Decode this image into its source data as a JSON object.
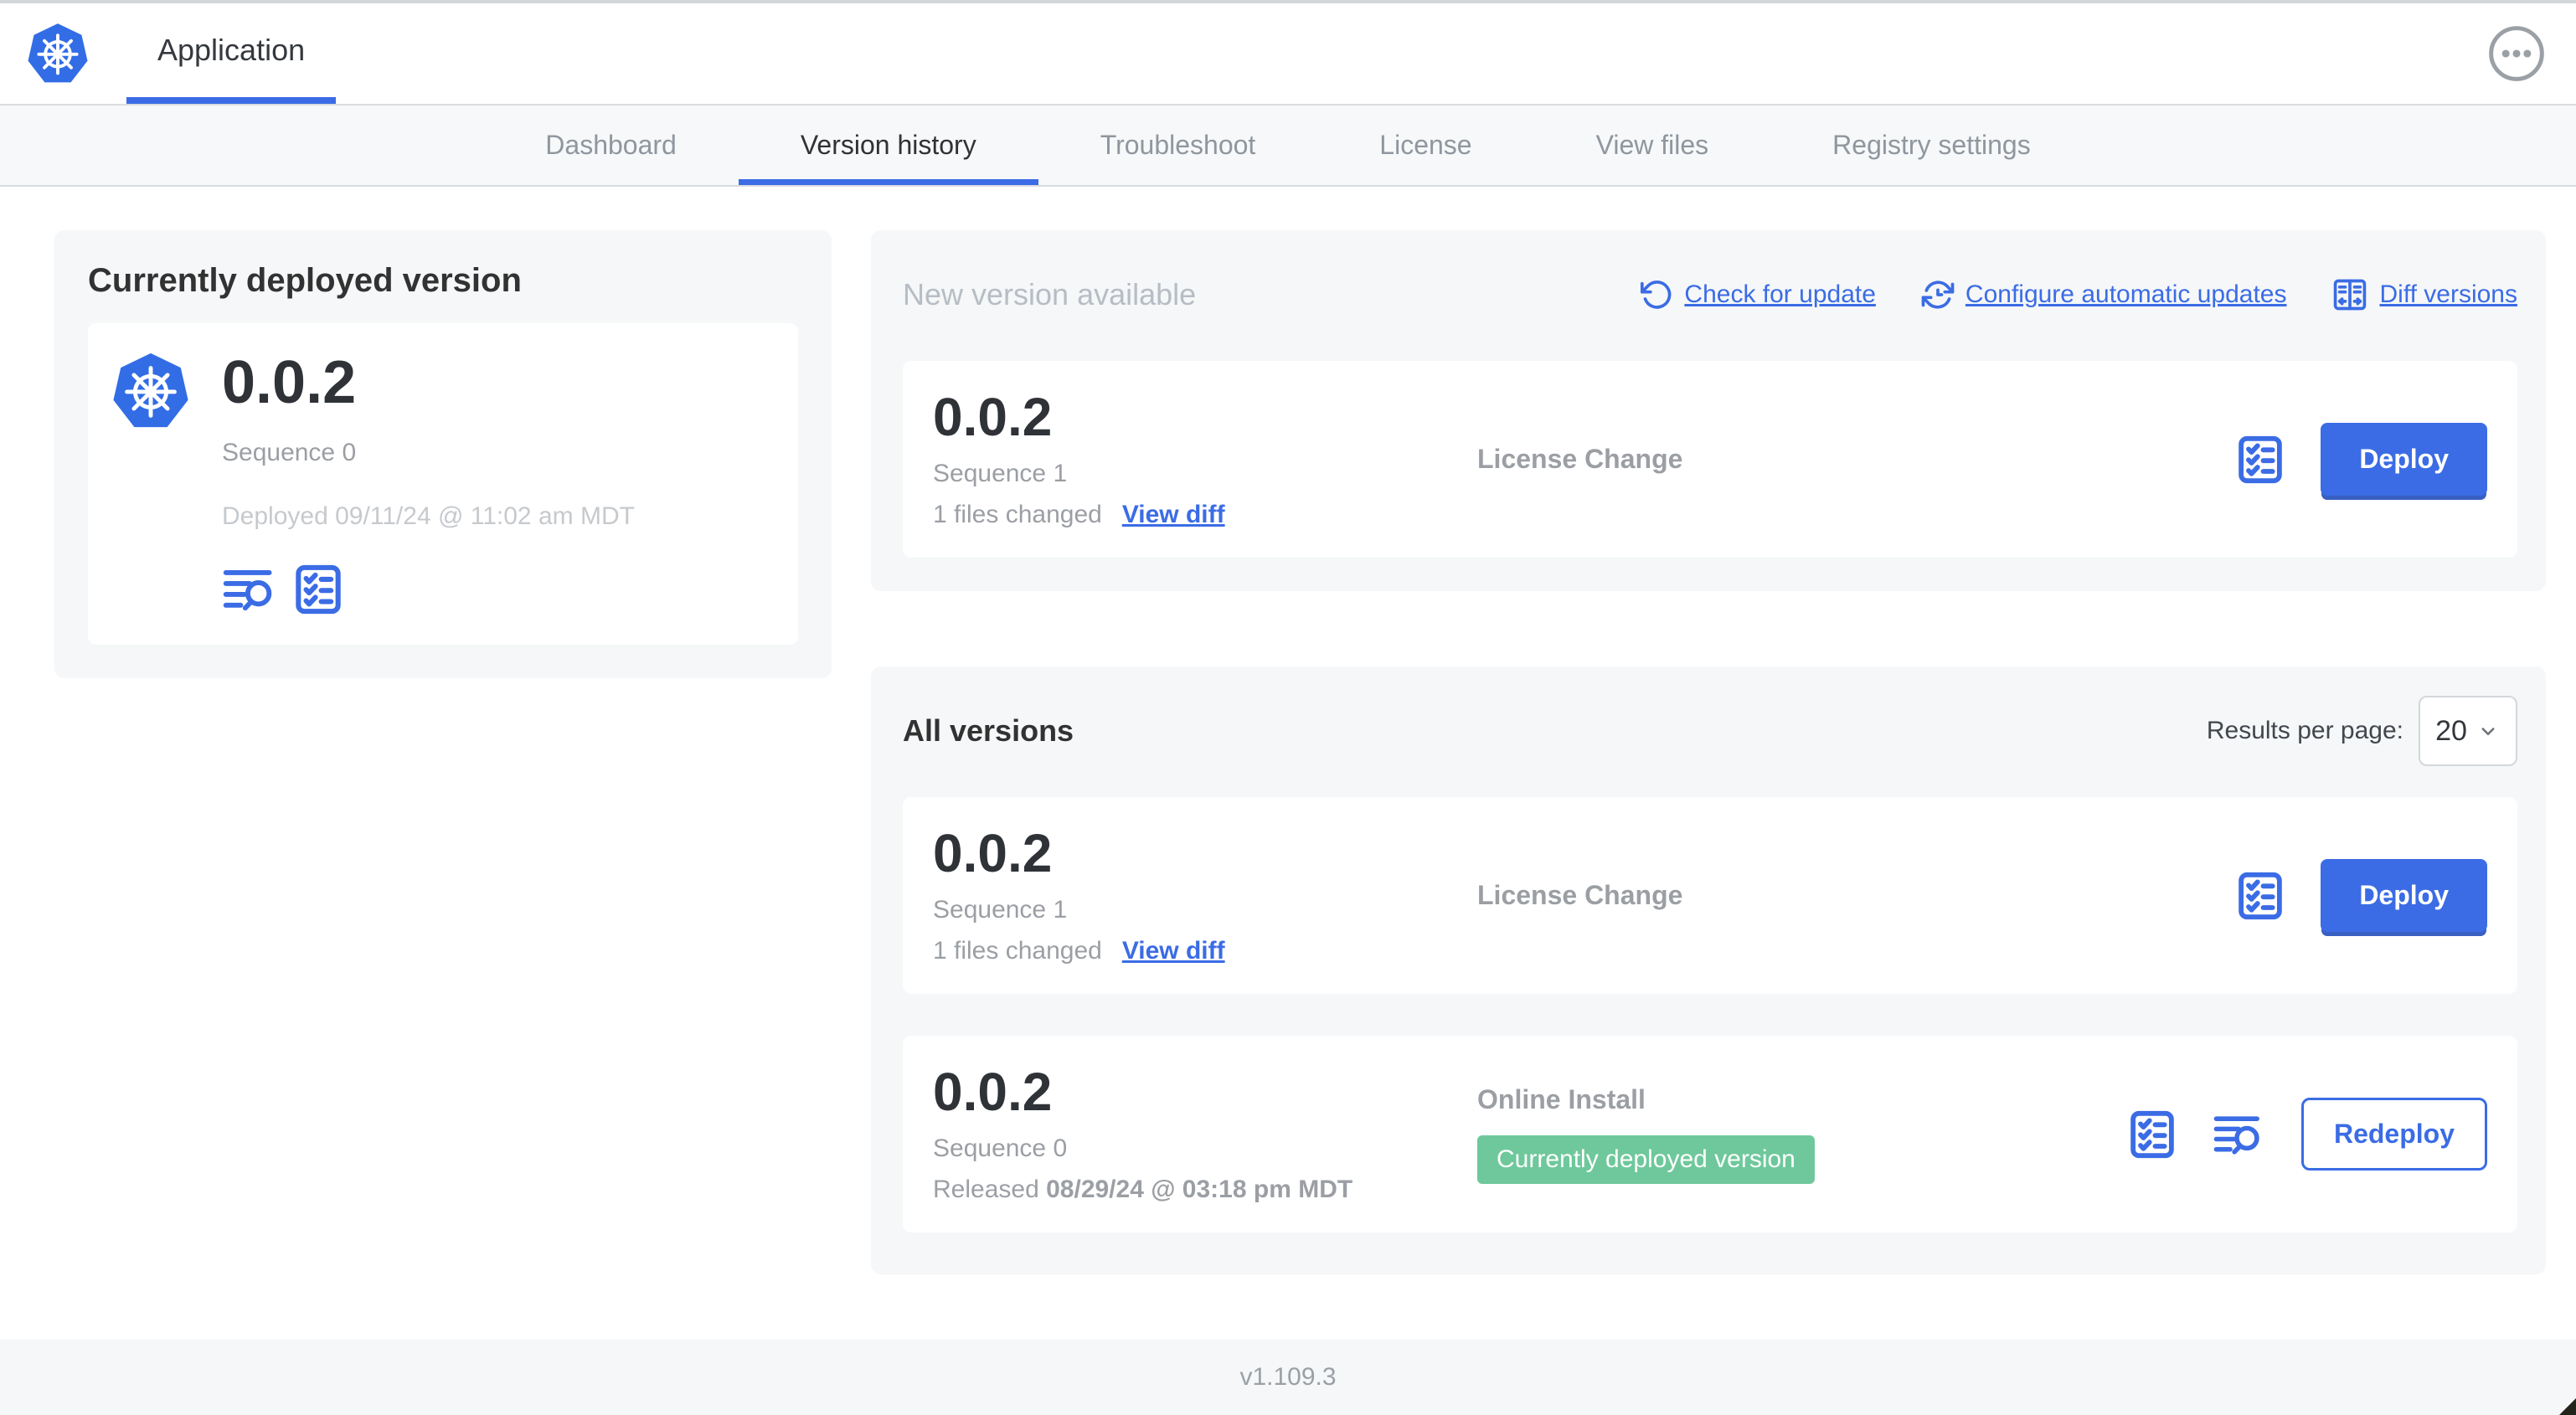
{
  "header": {
    "app_tab": "Application"
  },
  "nav": {
    "tabs": [
      "Dashboard",
      "Version history",
      "Troubleshoot",
      "License",
      "View files",
      "Registry settings"
    ],
    "active_tab": "Version history"
  },
  "current_version": {
    "title": "Currently deployed version",
    "version": "0.0.2",
    "sequence": "Sequence 0",
    "deployed": "Deployed 09/11/24 @ 11:02 am MDT"
  },
  "new_version": {
    "title": "New version available",
    "check_for_update": "Check for update",
    "configure_automatic_updates": "Configure automatic updates",
    "diff_versions": "Diff versions",
    "row": {
      "version": "0.0.2",
      "sequence": "Sequence 1",
      "files_changed": "1 files changed",
      "view_diff": "View diff",
      "label": "License Change",
      "deploy": "Deploy"
    }
  },
  "all_versions": {
    "title": "All versions",
    "results_per_page_label": "Results per page:",
    "results_per_page_value": "20",
    "row1": {
      "version": "0.0.2",
      "sequence": "Sequence 1",
      "files_changed": "1 files changed",
      "view_diff": "View diff",
      "label": "License Change",
      "deploy": "Deploy"
    },
    "row2": {
      "version": "0.0.2",
      "sequence": "Sequence 0",
      "released_prefix": "Released",
      "released_date": "08/29/24 @ 03:18 pm MDT",
      "label": "Online Install",
      "badge": "Currently deployed version",
      "redeploy": "Redeploy"
    }
  },
  "footer": {
    "app_version": "v1.109.3"
  },
  "icons": {
    "app_logo": "kubernetes-wheel-icon",
    "more": "ellipsis-circle-icon",
    "check_for_update": "rotate-ccw-icon",
    "configure_automatic_updates": "schedule-sync-clock-icon",
    "diff_versions": "split-diff-icon",
    "view_logs": "lines-magnifier-icon",
    "release_notes": "checklist-icon",
    "select": "chevron-down-icon"
  },
  "colors": {
    "accent_blue": "#3b6ce5",
    "kubernetes_blue": "#326de6",
    "success_green": "#6ec89b",
    "card_background": "#f5f7f8",
    "border": "#d9dcdf",
    "text_dark": "#323232",
    "text_gray": "#9b9fa4",
    "text_light_gray": "#c6c9cd"
  }
}
